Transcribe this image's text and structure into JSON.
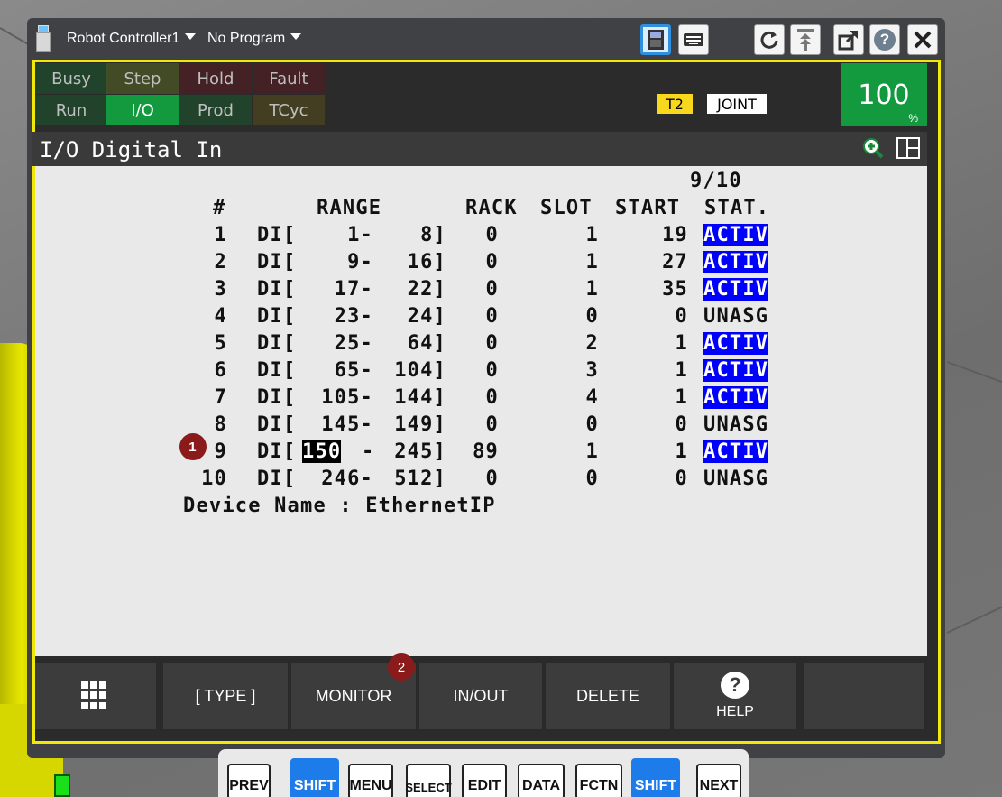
{
  "colors": {
    "screen_border": "#f1e80b",
    "active_status": "#0000ff",
    "override_bg": "#139a3e",
    "shift_key": "#1e7bea",
    "t2_bg": "#f7d81c"
  },
  "titlebar": {
    "controller": "Robot Controller1",
    "program": "No Program",
    "icons": [
      "teach-pendant-icon",
      "keyboard-icon",
      "reset-icon",
      "jog-icon",
      "external-link-icon",
      "help-icon",
      "close-icon"
    ]
  },
  "status": {
    "row1": [
      "Busy",
      "Step",
      "Hold",
      "Fault"
    ],
    "row2": [
      "Run",
      "I/O",
      "Prod",
      "TCyc"
    ],
    "mode": "T2",
    "coord": "JOINT",
    "override": "100",
    "override_unit": "%"
  },
  "screen": {
    "title": "I/O Digital In",
    "page": "9/10"
  },
  "table": {
    "headers": {
      "num": "#",
      "range": "RANGE",
      "rack": "RACK",
      "slot": "SLOT",
      "start": "START",
      "stat": "STAT."
    },
    "rows": [
      {
        "num": "1",
        "prefix": "DI[",
        "from": "1-",
        "to": "8]",
        "rack": "0",
        "slot": "1",
        "start": "19",
        "stat": "ACTIV"
      },
      {
        "num": "2",
        "prefix": "DI[",
        "from": "9-",
        "to": "16]",
        "rack": "0",
        "slot": "1",
        "start": "27",
        "stat": "ACTIV"
      },
      {
        "num": "3",
        "prefix": "DI[",
        "from": "17-",
        "to": "22]",
        "rack": "0",
        "slot": "1",
        "start": "35",
        "stat": "ACTIV"
      },
      {
        "num": "4",
        "prefix": "DI[",
        "from": "23-",
        "to": "24]",
        "rack": "0",
        "slot": "0",
        "start": "0",
        "stat": "UNASG"
      },
      {
        "num": "5",
        "prefix": "DI[",
        "from": "25-",
        "to": "64]",
        "rack": "0",
        "slot": "2",
        "start": "1",
        "stat": "ACTIV"
      },
      {
        "num": "6",
        "prefix": "DI[",
        "from": "65-",
        "to": "104]",
        "rack": "0",
        "slot": "3",
        "start": "1",
        "stat": "ACTIV"
      },
      {
        "num": "7",
        "prefix": "DI[",
        "from": "105-",
        "to": "144]",
        "rack": "0",
        "slot": "4",
        "start": "1",
        "stat": "ACTIV"
      },
      {
        "num": "8",
        "prefix": "DI[",
        "from": "145-",
        "to": "149]",
        "rack": "0",
        "slot": "0",
        "start": "0",
        "stat": "UNASG"
      },
      {
        "num": "9",
        "prefix": "DI[",
        "from": "150",
        "dash": "-",
        "to": "245]",
        "rack": "89",
        "slot": "1",
        "start": "1",
        "stat": "ACTIV"
      },
      {
        "num": "10",
        "prefix": "DI[",
        "from": "246-",
        "to": "512]",
        "rack": "0",
        "slot": "0",
        "start": "0",
        "stat": "UNASG"
      }
    ],
    "footer": "Device Name : EthernetIP"
  },
  "annotations": {
    "badge1": "1",
    "badge2": "2"
  },
  "fkeys": {
    "menu_icon": "grid-icon",
    "type": "[ TYPE ]",
    "monitor": "MONITOR",
    "inout": "IN/OUT",
    "delete": "DELETE",
    "help": "HELP",
    "help_glyph": "?"
  },
  "keypad": [
    "PREV",
    "SHIFT",
    "MENU",
    "SELECT",
    "EDIT",
    "DATA",
    "FCTN",
    "SHIFT",
    "NEXT"
  ]
}
